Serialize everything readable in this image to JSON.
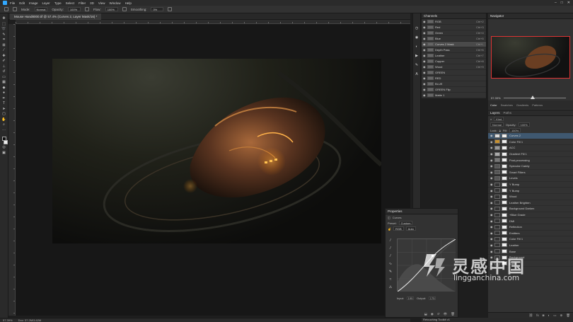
{
  "menubar": {
    "items": [
      "File",
      "Edit",
      "Image",
      "Layer",
      "Type",
      "Select",
      "Filter",
      "3D",
      "View",
      "Window",
      "Help"
    ],
    "window_controls": [
      "–",
      "□",
      "✕"
    ]
  },
  "options_bar": {
    "mode_label": "Mode:",
    "mode_value": "Normal",
    "opacity_label": "Opacity:",
    "opacity_value": "100%",
    "flow_label": "Flow:",
    "flow_value": "100%",
    "smoothing_label": "Smoothing:",
    "smoothing_value": "0%"
  },
  "document": {
    "tab_title": "Mouse Hand8000.tif @ 57.4% (Curves 2, Layer Mask/16) *",
    "zoom": "57.39%",
    "doc_info": "Doc: 37.2M/3.62M"
  },
  "channels": {
    "title": "Channels",
    "rows": [
      {
        "name": "RGB",
        "shortcut": "Ctrl+2"
      },
      {
        "name": "Red",
        "shortcut": "Ctrl+3"
      },
      {
        "name": "Green",
        "shortcut": "Ctrl+4"
      },
      {
        "name": "Blue",
        "shortcut": "Ctrl+5"
      },
      {
        "name": "Curves 2 Mask",
        "shortcut": "Ctrl+\\",
        "selected": true
      },
      {
        "name": "Depth Pass",
        "shortcut": "Ctrl+6"
      },
      {
        "name": "Leather",
        "shortcut": "Ctrl+7"
      },
      {
        "name": "Copper",
        "shortcut": "Ctrl+8"
      },
      {
        "name": "Wood",
        "shortcut": "Ctrl+9"
      },
      {
        "name": "GREEN",
        "shortcut": ""
      },
      {
        "name": "RED",
        "shortcut": ""
      },
      {
        "name": "BLUE",
        "shortcut": ""
      },
      {
        "name": "GREEN Flip",
        "shortcut": ""
      },
      {
        "name": "Matte 1",
        "shortcut": ""
      }
    ]
  },
  "navigator": {
    "title": "Navigator",
    "zoom": "57.39%"
  },
  "libraries": {
    "tabs": [
      "Color",
      "Swatches",
      "Gradients",
      "Patterns"
    ]
  },
  "layers": {
    "tabs": [
      "Layers",
      "Paths"
    ],
    "kind_label": "Kind",
    "blend_mode": "Normal",
    "opacity_label": "Opacity:",
    "opacity_value": "100%",
    "lock_label": "Lock:",
    "fill_label": "Fill:",
    "fill_value": "100%",
    "rows": [
      {
        "name": "Curves 2",
        "selected": true,
        "thumb": "#ddd"
      },
      {
        "name": "Color Fill 1",
        "thumb": "#c8902e"
      },
      {
        "name": "ACC",
        "thumb": "#999"
      },
      {
        "name": "Gradient Fill 1",
        "thumb": "#aaa"
      },
      {
        "name": "Post-processing",
        "thumb": "#777"
      },
      {
        "name": "Specular Caddy",
        "thumb": "#555"
      },
      {
        "name": "Smart Filters",
        "thumb": "#555"
      },
      {
        "name": "Levels",
        "thumb": "#555"
      },
      {
        "name": "Y Bump",
        "thumb": "#333"
      },
      {
        "name": "Y Bump",
        "thumb": "#333"
      },
      {
        "name": "Wood",
        "thumb": "#333"
      },
      {
        "name": "Leather Brighten",
        "thumb": "#333"
      },
      {
        "name": "Background Darken",
        "thumb": "#333"
      },
      {
        "name": "+Blue Grade",
        "thumb": "#333"
      },
      {
        "name": "DMI",
        "thumb": "#333"
      },
      {
        "name": "Reflection",
        "thumb": "#333"
      },
      {
        "name": "Emitters",
        "thumb": "#333"
      },
      {
        "name": "Color Fill 1",
        "thumb": "#333"
      },
      {
        "name": "Leather",
        "thumb": "#333"
      },
      {
        "name": "Base",
        "thumb": "#333"
      },
      {
        "name": "Background",
        "thumb": "#333"
      },
      {
        "name": "Cable",
        "thumb": "#333"
      }
    ]
  },
  "properties": {
    "title": "Properties",
    "subtitle": "Curves",
    "preset_label": "Preset:",
    "preset_value": "Custom",
    "channel_value": "RGB",
    "auto_label": "Auto",
    "input_label": "Input:",
    "input_value": "199",
    "output_label": "Output:",
    "output_value": "175"
  },
  "bottom_status": {
    "text": "Retouching Toolkit v1"
  },
  "watermark": {
    "chinese": "灵感中国",
    "url": "lingganchina.com"
  }
}
